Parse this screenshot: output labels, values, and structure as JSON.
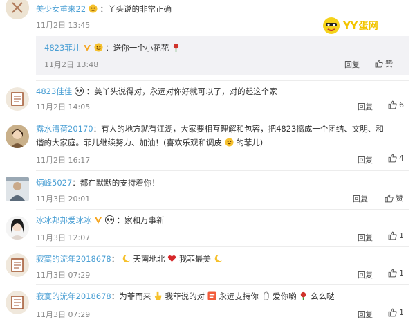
{
  "comments": [
    {
      "user": "美少女重来22",
      "text": "丫头说的非常正确",
      "time": "11月2日 13:45"
    },
    {
      "user": "4823菲儿",
      "text": "送你一个小花花",
      "time": "11月2日 13:48",
      "reply_label": "回复",
      "like_label": "赞"
    },
    {
      "user": "4823佳佳",
      "text": "美丫头说得对，永远对你好就可以了，对的起这个家",
      "time": "11月2日 14:05",
      "reply_label": "回复",
      "likes": "6"
    },
    {
      "user": "露水清荷20170",
      "text_line1": "有人的地方就有江湖，大家要相互理解和包容，把4823搞成一个团结、文明、和",
      "text_line2a": "谐的大家庭。菲儿继续努力、加油！(喜欢乐观和调皮",
      "text_line2b": "的菲儿)",
      "time": "11月2日 16:17",
      "reply_label": "回复",
      "likes": "4"
    },
    {
      "user": "炳峰5027",
      "text": "都在默默的支持着你！",
      "time": "11月3日 20:01",
      "reply_label": "回复",
      "like_label": "赞"
    },
    {
      "user": "冰冰邦邦爱冰冰",
      "text": "家和万事新",
      "time": "11月3日 12:07",
      "reply_label": "回复",
      "likes": "1"
    },
    {
      "user": "寂寞的流年2018678",
      "text_a": "天南地北",
      "text_b": "我菲最美",
      "time": "11月3日 07:29",
      "reply_label": "回复",
      "likes": "1"
    },
    {
      "user": "寂寞的流年2018678",
      "text_a": "为菲而来",
      "text_b": "我菲说的对",
      "text_c": "永远支持你",
      "text_d": "爱你哟",
      "text_e": "么么哒",
      "time": "11月3日 07:29",
      "reply_label": "回复",
      "likes": "1"
    }
  ],
  "colon": "：",
  "logo": {
    "text": "YY",
    "text2": "蛋网"
  },
  "colors": {
    "username": "#4a9fd4",
    "time": "#8a8a8a",
    "subbox": "#f2f2f5",
    "logo": "#f2c400"
  }
}
